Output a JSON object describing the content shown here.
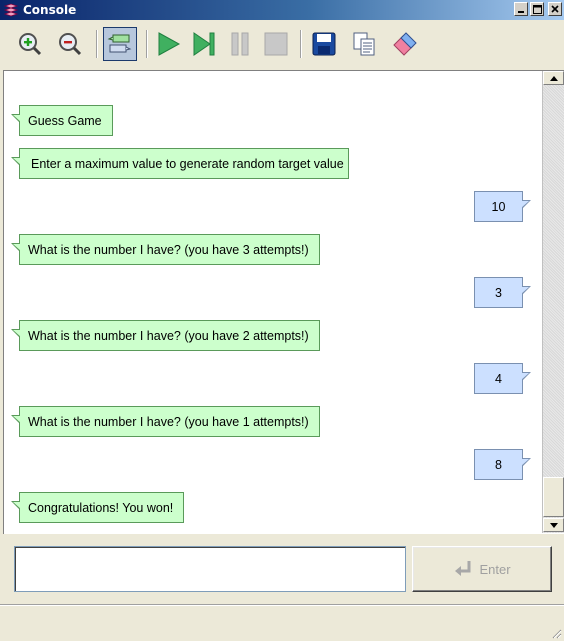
{
  "window": {
    "title": "Console"
  },
  "toolbar": {
    "buttons": [
      {
        "icon": "zoom-in-icon"
      },
      {
        "icon": "zoom-out-icon"
      },
      {
        "icon": "message-view-icon",
        "active": true
      },
      {
        "icon": "run-icon"
      },
      {
        "icon": "step-icon"
      },
      {
        "icon": "pause-icon"
      },
      {
        "icon": "stop-icon"
      },
      {
        "icon": "save-icon"
      },
      {
        "icon": "copy-icon"
      },
      {
        "icon": "eraser-icon"
      }
    ]
  },
  "messages": [
    {
      "from": "system",
      "text": "Guess Game"
    },
    {
      "from": "system",
      "text": "Enter a maximum value to generate random target value"
    },
    {
      "from": "user",
      "text": "10"
    },
    {
      "from": "system",
      "text": "What is the number I have? (you have 3 attempts!)"
    },
    {
      "from": "user",
      "text": "3"
    },
    {
      "from": "system",
      "text": "What is the number I have? (you have 2 attempts!)"
    },
    {
      "from": "user",
      "text": "4"
    },
    {
      "from": "system",
      "text": "What is the number I have? (you have 1 attempts!)"
    },
    {
      "from": "user",
      "text": "8"
    },
    {
      "from": "system",
      "text": "Congratulations! You won!"
    }
  ],
  "input": {
    "value": "",
    "enter_label": "Enter"
  },
  "colors": {
    "system_bubble": "#ccffcc",
    "user_bubble": "#cce0ff",
    "title_bar": "#0a246a"
  }
}
